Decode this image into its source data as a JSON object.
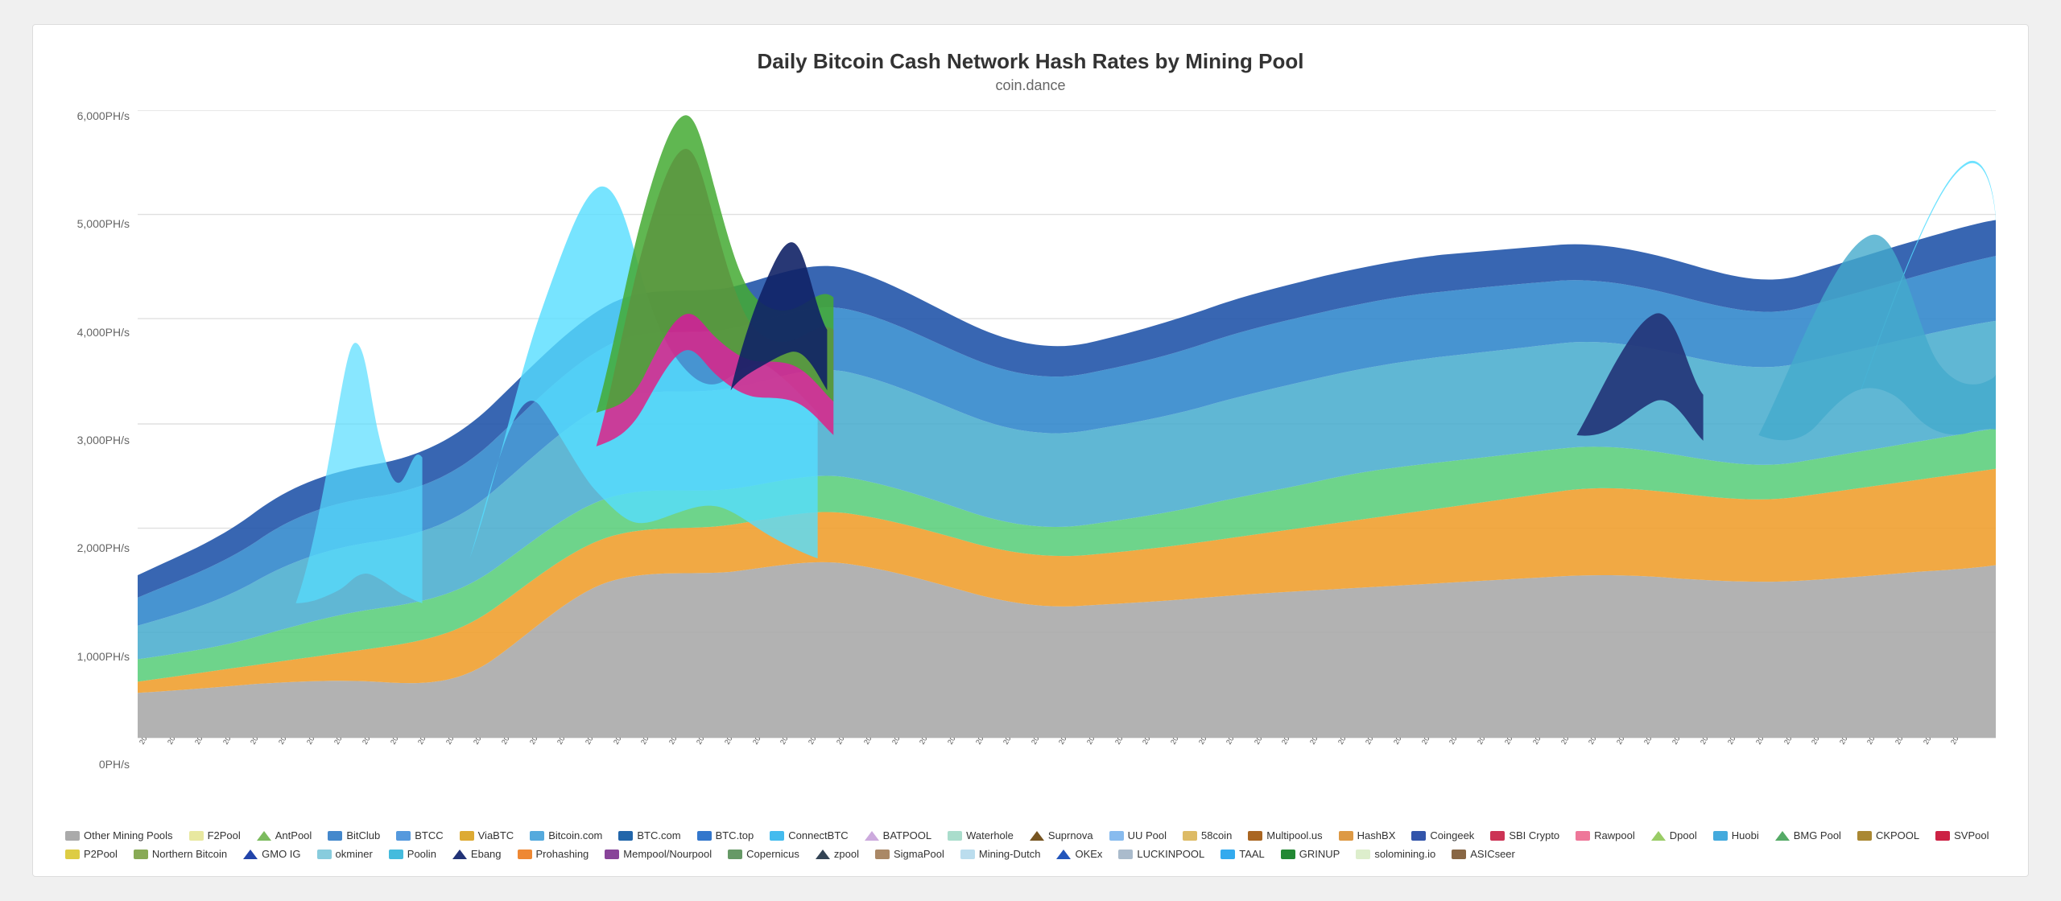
{
  "title": "Daily Bitcoin Cash Network Hash Rates by Mining Pool",
  "subtitle": "coin.dance",
  "yAxis": {
    "labels": [
      "6,000PH/s",
      "5,000PH/s",
      "4,000PH/s",
      "3,000PH/s",
      "2,000PH/s",
      "1,000PH/s",
      "0PH/s"
    ]
  },
  "legend": [
    {
      "label": "Other Mining Pools",
      "color": "#aaaaaa",
      "shape": "square"
    },
    {
      "label": "F2Pool",
      "color": "#e8e8a0",
      "shape": "square"
    },
    {
      "label": "AntPool",
      "color": "#7cbb5e",
      "shape": "triangle"
    },
    {
      "label": "BitClub",
      "color": "#4488cc",
      "shape": "square"
    },
    {
      "label": "BTCC",
      "color": "#5599dd",
      "shape": "square"
    },
    {
      "label": "ViaBTC",
      "color": "#ddaa33",
      "shape": "square"
    },
    {
      "label": "Bitcoin.com",
      "color": "#55aadd",
      "shape": "square"
    },
    {
      "label": "BTC.com",
      "color": "#2266aa",
      "shape": "square"
    },
    {
      "label": "BTC.top",
      "color": "#3377cc",
      "shape": "square"
    },
    {
      "label": "ConnectBTC",
      "color": "#44bbee",
      "shape": "square"
    },
    {
      "label": "BATPOOL",
      "color": "#ccaadd",
      "shape": "triangle"
    },
    {
      "label": "Waterhole",
      "color": "#aaddcc",
      "shape": "square"
    },
    {
      "label": "Suprnova",
      "color": "#775522",
      "shape": "triangle"
    },
    {
      "label": "UU Pool",
      "color": "#88bbee",
      "shape": "square"
    },
    {
      "label": "58coin",
      "color": "#ddbb66",
      "shape": "square"
    },
    {
      "label": "Multipool.us",
      "color": "#aa6622",
      "shape": "square"
    },
    {
      "label": "HashBX",
      "color": "#dd9944",
      "shape": "square"
    },
    {
      "label": "Coingeek",
      "color": "#3355aa",
      "shape": "square"
    },
    {
      "label": "SBI Crypto",
      "color": "#cc3355",
      "shape": "square"
    },
    {
      "label": "Rawpool",
      "color": "#ee7799",
      "shape": "square"
    },
    {
      "label": "Dpool",
      "color": "#99cc66",
      "shape": "triangle"
    },
    {
      "label": "Huobi",
      "color": "#44aadd",
      "shape": "square"
    },
    {
      "label": "BMG Pool",
      "color": "#55aa66",
      "shape": "triangle"
    },
    {
      "label": "CKPOOL",
      "color": "#aa8833",
      "shape": "square"
    },
    {
      "label": "SVPool",
      "color": "#cc2244",
      "shape": "square"
    },
    {
      "label": "P2Pool",
      "color": "#ddcc44",
      "shape": "square"
    },
    {
      "label": "Northern Bitcoin",
      "color": "#88aa55",
      "shape": "square"
    },
    {
      "label": "GMO IG",
      "color": "#2244aa",
      "shape": "triangle"
    },
    {
      "label": "okminer",
      "color": "#88ccdd",
      "shape": "square"
    },
    {
      "label": "Poolin",
      "color": "#44bbdd",
      "shape": "square"
    },
    {
      "label": "Ebang",
      "color": "#223377",
      "shape": "triangle"
    },
    {
      "label": "Prohashing",
      "color": "#ee8833",
      "shape": "square"
    },
    {
      "label": "Mempool/Nourpool",
      "color": "#884499",
      "shape": "square"
    },
    {
      "label": "Copernicus",
      "color": "#669966",
      "shape": "square"
    },
    {
      "label": "zpool",
      "color": "#334455",
      "shape": "triangle"
    },
    {
      "label": "SigmaPool",
      "color": "#aa8866",
      "shape": "square"
    },
    {
      "label": "Mining-Dutch",
      "color": "#bbddee",
      "shape": "square"
    },
    {
      "label": "OKEx",
      "color": "#2255bb",
      "shape": "triangle"
    },
    {
      "label": "LUCKINPOOL",
      "color": "#aabbcc",
      "shape": "square"
    },
    {
      "label": "TAAL",
      "color": "#33aaee",
      "shape": "square"
    },
    {
      "label": "GRINUP",
      "color": "#228833",
      "shape": "square"
    },
    {
      "label": "solomining.io",
      "color": "#ddeecc",
      "shape": "square"
    },
    {
      "label": "ASICseer",
      "color": "#886644",
      "shape": "square"
    }
  ]
}
